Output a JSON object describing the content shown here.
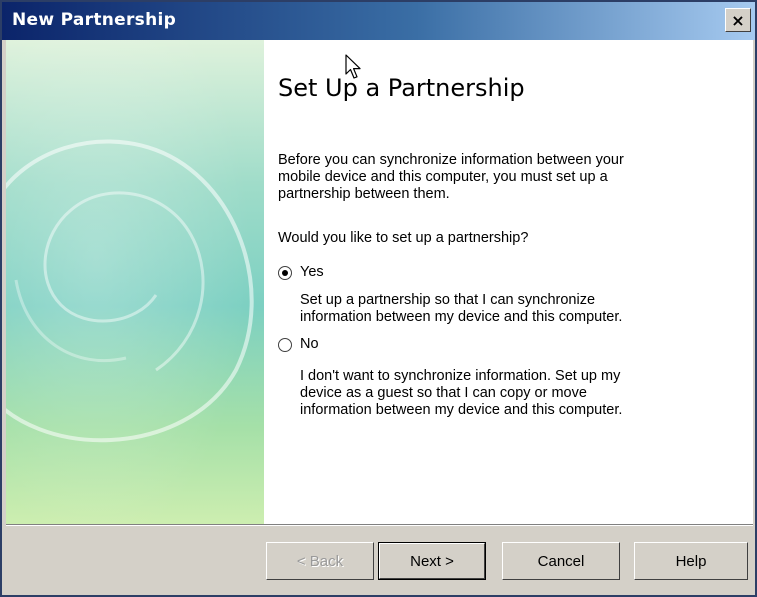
{
  "window": {
    "title": "New Partnership",
    "close_glyph": "×"
  },
  "page": {
    "heading": "Set Up a Partnership",
    "intro_lines": [
      "Before you can synchronize information between your",
      "mobile device and this computer, you must set up a",
      "partnership between them."
    ],
    "question": "Would you like to set up a partnership?",
    "options": [
      {
        "label": "Yes",
        "selected": true,
        "description_lines": [
          "Set up a partnership so that I can synchronize",
          "information between my device and this computer."
        ]
      },
      {
        "label": "No",
        "selected": false,
        "description_lines": [
          "I don't want to synchronize information. Set up my",
          "device as a guest so that I can copy or move",
          "information between my device and this computer."
        ]
      }
    ]
  },
  "buttons": {
    "back": "< Back",
    "next": "Next >",
    "cancel": "Cancel",
    "help": "Help"
  },
  "icons": {
    "close": "close-icon",
    "cursor": "mouse-cursor-icon"
  },
  "colors": {
    "titlebar_start": "#0b246a",
    "titlebar_end": "#a6caf0",
    "panel_teal": "#7dd0c2",
    "face": "#d4d0c8"
  }
}
